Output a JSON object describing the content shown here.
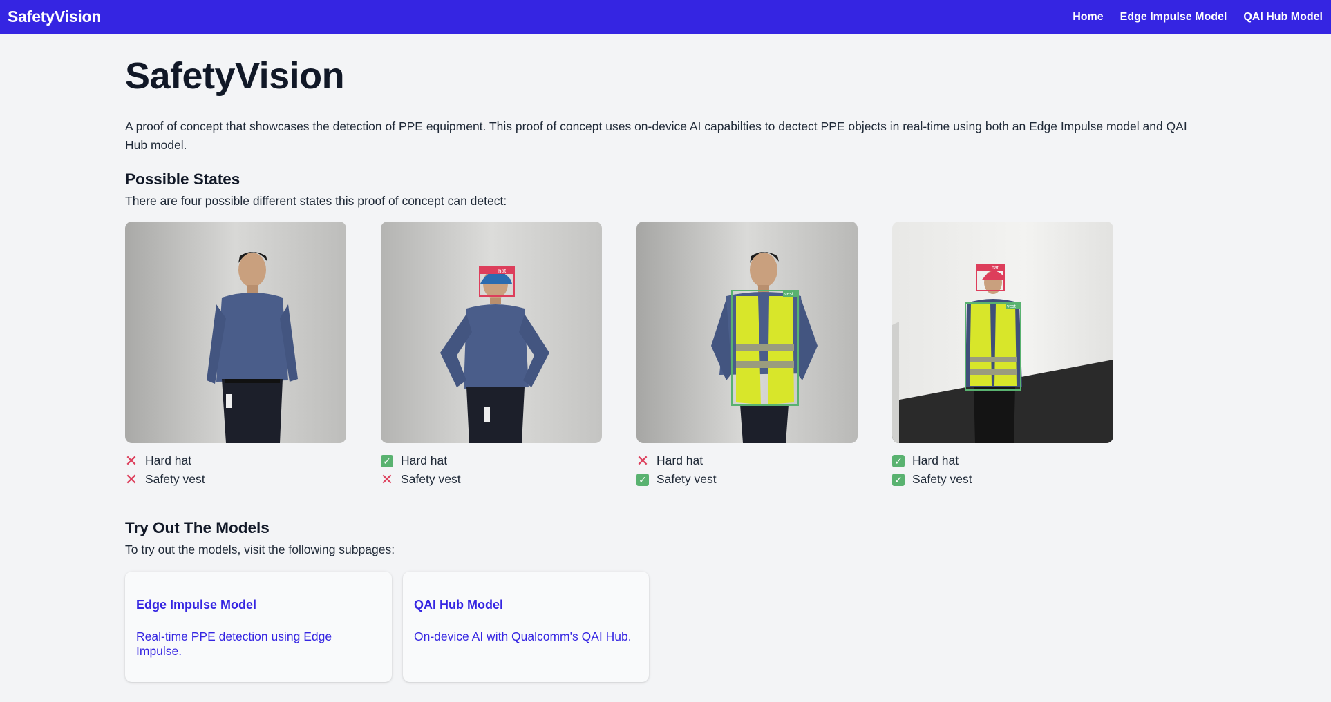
{
  "nav": {
    "brand": "SafetyVision",
    "links": [
      "Home",
      "Edge Impulse Model",
      "QAI Hub Model"
    ]
  },
  "main": {
    "title": "SafetyVision",
    "intro": "A proof of concept that showcases the detection of PPE equipment. This proof of concept uses on-device AI capabilties to dectect PPE objects in real-time using both an Edge Impulse model and QAI Hub model.",
    "states_heading": "Possible States",
    "states_text": "There are four possible different states this proof of concept can detect:",
    "states": [
      {
        "items": [
          {
            "label": "Hard hat",
            "detected": false
          },
          {
            "label": "Safety vest",
            "detected": false
          }
        ]
      },
      {
        "items": [
          {
            "label": "Hard hat",
            "detected": true
          },
          {
            "label": "Safety vest",
            "detected": false
          }
        ],
        "box_labels": [
          "hat"
        ]
      },
      {
        "items": [
          {
            "label": "Hard hat",
            "detected": false
          },
          {
            "label": "Safety vest",
            "detected": true
          }
        ],
        "box_labels": [
          "vest"
        ]
      },
      {
        "items": [
          {
            "label": "Hard hat",
            "detected": true
          },
          {
            "label": "Safety vest",
            "detected": true
          }
        ],
        "box_labels": [
          "hat",
          "vest"
        ]
      }
    ],
    "models_heading": "Try Out The Models",
    "models_text": "To try out the models, visit the following subpages:",
    "cards": [
      {
        "title": "Edge Impulse Model",
        "desc": "Real-time PPE detection using Edge Impulse."
      },
      {
        "title": "QAI Hub Model",
        "desc": "On-device AI with Qualcomm's QAI Hub."
      }
    ]
  },
  "colors": {
    "brand": "#3525e2",
    "not_detected": "#dd3e5b",
    "detected": "#59b270",
    "hat_box": "#dd3e5b",
    "vest_box": "#59b270"
  }
}
